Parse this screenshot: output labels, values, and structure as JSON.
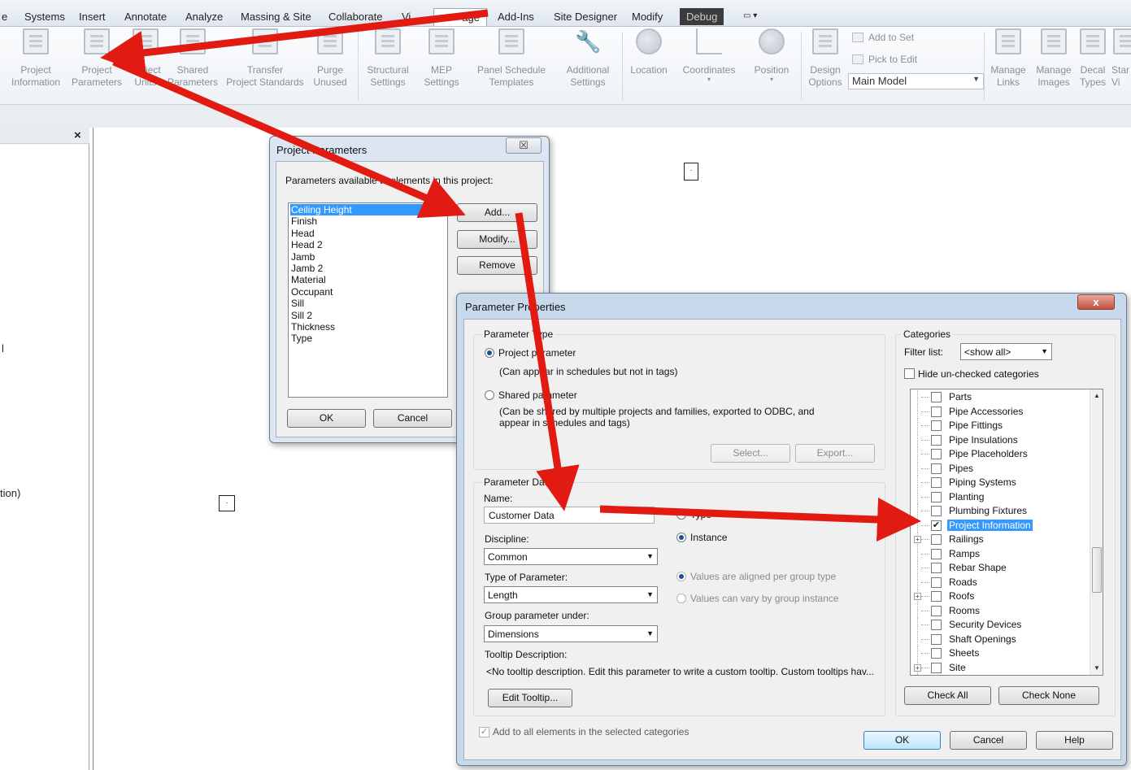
{
  "menu": {
    "tabs": [
      "e",
      "Systems",
      "Insert",
      "Annotate",
      "Analyze",
      "Massing & Site",
      "Collaborate",
      "Vi",
      "age",
      "Add-Ins",
      "Site Designer",
      "Modify",
      "Debug"
    ],
    "active_tab": "age"
  },
  "ribbon": {
    "buttons": [
      {
        "l1": "Project",
        "l2": "Information"
      },
      {
        "l1": "Project",
        "l2": "Parameters"
      },
      {
        "l1": "Project",
        "l2": "Units"
      },
      {
        "l1": "Shared",
        "l2": "Parameters"
      },
      {
        "l1": "Transfer",
        "l2": "Project Standards"
      },
      {
        "l1": "Purge",
        "l2": "Unused"
      },
      {
        "l1": "Structural",
        "l2": "Settings"
      },
      {
        "l1": "MEP",
        "l2": "Settings"
      },
      {
        "l1": "Panel Schedule",
        "l2": "Templates"
      },
      {
        "l1": "Additional",
        "l2": "Settings"
      },
      {
        "l1": "Location",
        "l2": ""
      },
      {
        "l1": "Coordinates",
        "l2": ""
      },
      {
        "l1": "Position",
        "l2": ""
      },
      {
        "l1": "Design",
        "l2": "Options"
      },
      {
        "l1": "Manage",
        "l2": "Links"
      },
      {
        "l1": "Manage",
        "l2": "Images"
      },
      {
        "l1": "Decal",
        "l2": "Types"
      },
      {
        "l1": "Star",
        "l2": "Vi"
      }
    ],
    "add_to_set": "Add to Set",
    "pick_to_edit": "Pick to Edit",
    "main_model": "Main Model"
  },
  "left_panel": {
    "close": "×",
    "frag1": "tion)",
    "frag2": "l"
  },
  "project_parameters": {
    "title": "Project Parameters",
    "close": "☒",
    "label": "Parameters available to elements in this project:",
    "items": [
      "Ceiling Height",
      "Finish",
      "Head",
      "Head 2",
      "Jamb",
      "Jamb 2",
      "Material",
      "Occupant",
      "Sill",
      "Sill 2",
      "Thickness",
      "Type"
    ],
    "selected": "Ceiling Height",
    "add": "Add...",
    "modify": "Modify...",
    "remove": "Remove",
    "ok": "OK",
    "cancel": "Cancel"
  },
  "parameter_properties": {
    "title": "Parameter Properties",
    "close": "x",
    "parameter_type": "Parameter Type",
    "project_parameter": "Project parameter",
    "project_parameter_note": "(Can appear in schedules but not in tags)",
    "shared_parameter": "Shared parameter",
    "shared_note_1": "(Can be shared by multiple projects and families, exported to ODBC, and",
    "shared_note_2": "appear in schedules and tags)",
    "select": "Select...",
    "export": "Export...",
    "parameter_data": "Parameter Data",
    "name_label": "Name:",
    "name_value": "Customer Data",
    "type_label": "Type",
    "instance_label": "Instance",
    "discipline_label": "Discipline:",
    "discipline_value": "Common",
    "type_of_parameter_label": "Type of Parameter:",
    "type_of_parameter_value": "Length",
    "group_label": "Group parameter under:",
    "group_value": "Dimensions",
    "aligned": "Values are aligned per group type",
    "vary": "Values can vary by group instance",
    "tooltip_label": "Tooltip Description:",
    "tooltip_text": "<No tooltip description. Edit this parameter to write a custom tooltip. Custom tooltips hav...",
    "edit_tooltip": "Edit Tooltip...",
    "add_all": "Add to all elements in the selected categories",
    "categories": "Categories",
    "filter_list": "Filter list:",
    "filter_value": "<show all>",
    "hide_unchecked": "Hide un-checked categories",
    "category_items": [
      {
        "name": "Parts",
        "checked": false,
        "expand": false
      },
      {
        "name": "Pipe Accessories",
        "checked": false,
        "expand": false
      },
      {
        "name": "Pipe Fittings",
        "checked": false,
        "expand": false
      },
      {
        "name": "Pipe Insulations",
        "checked": false,
        "expand": false
      },
      {
        "name": "Pipe Placeholders",
        "checked": false,
        "expand": false
      },
      {
        "name": "Pipes",
        "checked": false,
        "expand": false
      },
      {
        "name": "Piping Systems",
        "checked": false,
        "expand": false
      },
      {
        "name": "Planting",
        "checked": false,
        "expand": false
      },
      {
        "name": "Plumbing Fixtures",
        "checked": false,
        "expand": false
      },
      {
        "name": "Project Information",
        "checked": true,
        "expand": false,
        "selected": true
      },
      {
        "name": "Railings",
        "checked": false,
        "expand": true
      },
      {
        "name": "Ramps",
        "checked": false,
        "expand": false
      },
      {
        "name": "Rebar Shape",
        "checked": false,
        "expand": false
      },
      {
        "name": "Roads",
        "checked": false,
        "expand": false
      },
      {
        "name": "Roofs",
        "checked": false,
        "expand": true
      },
      {
        "name": "Rooms",
        "checked": false,
        "expand": false
      },
      {
        "name": "Security Devices",
        "checked": false,
        "expand": false
      },
      {
        "name": "Shaft Openings",
        "checked": false,
        "expand": false
      },
      {
        "name": "Sheets",
        "checked": false,
        "expand": false
      },
      {
        "name": "Site",
        "checked": false,
        "expand": true
      }
    ],
    "check_all": "Check All",
    "check_none": "Check None",
    "ok": "OK",
    "cancel": "Cancel",
    "help": "Help"
  },
  "colors": {
    "arrow": "#e11b12",
    "selection": "#3399ff"
  }
}
